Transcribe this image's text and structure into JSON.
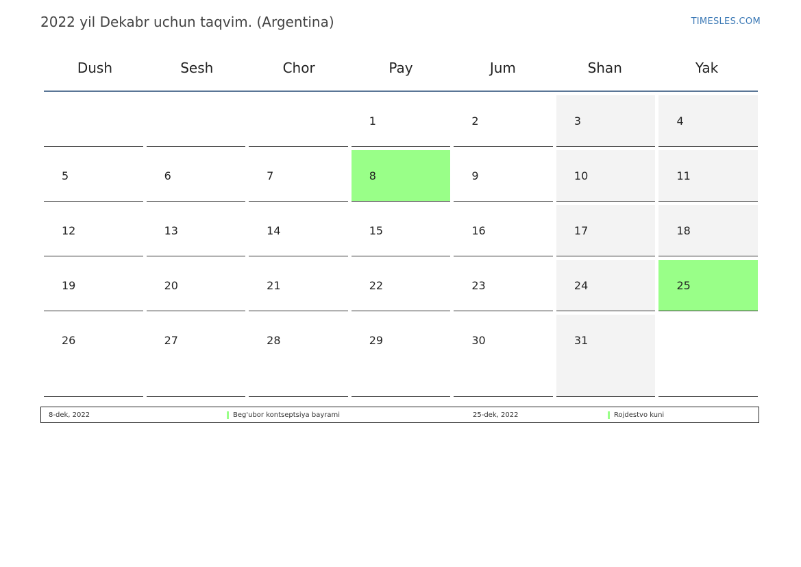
{
  "header": {
    "title": "2022 yil Dekabr uchun taqvim. (Argentina)",
    "site": "TIMESLES.COM"
  },
  "calendar": {
    "weekdays": [
      "Dush",
      "Sesh",
      "Chor",
      "Pay",
      "Jum",
      "Shan",
      "Yak"
    ],
    "weeks": [
      [
        "",
        "",
        "",
        "1",
        "2",
        "3",
        "4"
      ],
      [
        "5",
        "6",
        "7",
        "8",
        "9",
        "10",
        "11"
      ],
      [
        "12",
        "13",
        "14",
        "15",
        "16",
        "17",
        "18"
      ],
      [
        "19",
        "20",
        "21",
        "22",
        "23",
        "24",
        "25"
      ],
      [
        "26",
        "27",
        "28",
        "29",
        "30",
        "31",
        ""
      ]
    ],
    "holidays": [
      "8",
      "25"
    ],
    "colors": {
      "holiday": "#99ff88",
      "weekend": "#f3f3f3",
      "header_rule": "#5a7696"
    }
  },
  "legend": [
    {
      "date": "8-dek, 2022",
      "name": "Beg'ubor kontseptsiya bayrami"
    },
    {
      "date": "25-dek, 2022",
      "name": "Rojdestvo kuni"
    }
  ]
}
